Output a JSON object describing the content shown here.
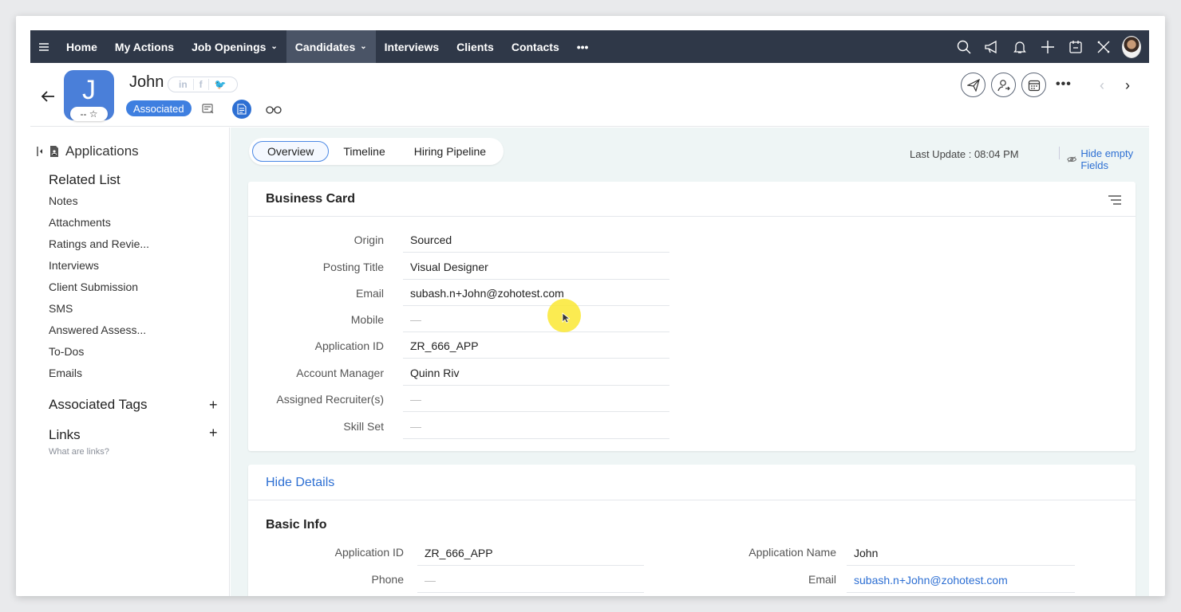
{
  "nav": {
    "items": [
      "Home",
      "My Actions",
      "Job Openings",
      "Candidates",
      "Interviews",
      "Clients",
      "Contacts"
    ],
    "more": "•••"
  },
  "header": {
    "name": "John",
    "avatar_letter": "J",
    "rating": "-- ☆",
    "social": [
      "in",
      "f",
      "🐦"
    ],
    "status_badge": "Associated",
    "more": "•••",
    "prev": "‹",
    "next": "›"
  },
  "sidebar": {
    "title": "Applications",
    "related_title": "Related List",
    "related": [
      "Notes",
      "Attachments",
      "Ratings and Revie...",
      "Interviews",
      "Client Submission",
      "SMS",
      "Answered Assess...",
      "To-Dos",
      "Emails"
    ],
    "tags_title": "Associated Tags",
    "links_title": "Links",
    "links_hint": "What are links?",
    "plus": "+"
  },
  "main": {
    "tabs": [
      "Overview",
      "Timeline",
      "Hiring Pipeline"
    ],
    "last_update": "Last Update : 08:04 PM",
    "hide_empty": "Hide empty Fields",
    "business_card": {
      "title": "Business Card",
      "fields": [
        {
          "label": "Origin",
          "value": "Sourced"
        },
        {
          "label": "Posting Title",
          "value": "Visual Designer"
        },
        {
          "label": "Email",
          "value": "subash.n+John@zohotest.com"
        },
        {
          "label": "Mobile",
          "value": "—"
        },
        {
          "label": "Application ID",
          "value": "ZR_666_APP"
        },
        {
          "label": "Account Manager",
          "value": "Quinn Riv"
        },
        {
          "label": "Assigned Recruiter(s)",
          "value": "—"
        },
        {
          "label": "Skill Set",
          "value": "—"
        }
      ]
    },
    "details": {
      "hide_details": "Hide Details",
      "basic_info": "Basic Info",
      "left": [
        {
          "label": "Application ID",
          "value": "ZR_666_APP"
        },
        {
          "label": "Phone",
          "value": "—"
        }
      ],
      "right": [
        {
          "label": "Application Name",
          "value": "John"
        },
        {
          "label": "Email",
          "value": "subash.n+John@zohotest.com"
        }
      ]
    }
  },
  "colors": {
    "nav_bg": "#2f3848",
    "accent": "#2d6fd3",
    "avatar_bg": "#4a7fd9",
    "main_bg": "#eef5f5"
  }
}
